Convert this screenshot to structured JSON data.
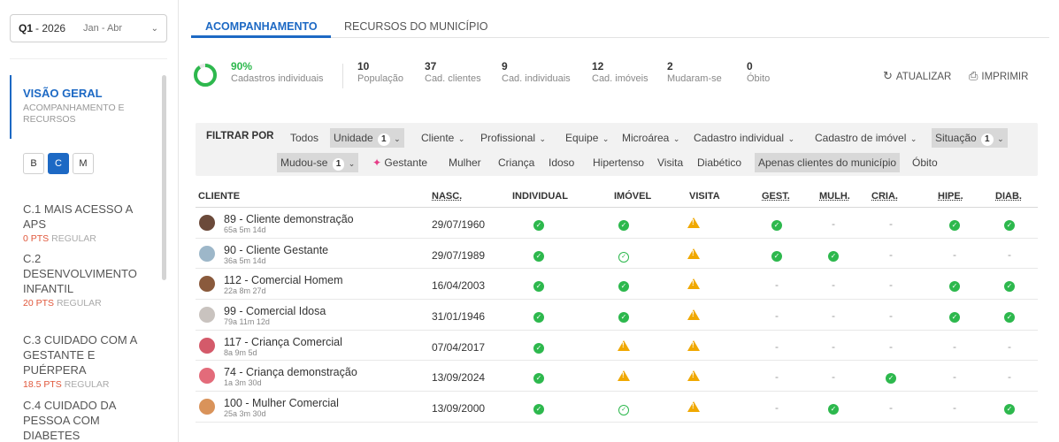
{
  "sidebar": {
    "quarter": "Q1",
    "year": "- 2026",
    "months": "Jan - Abr",
    "overview_title": "VISÃO GERAL",
    "overview_sub": "ACOMPANHAMENTO E RECURSOS",
    "level_buttons": [
      "B",
      "C",
      "M"
    ],
    "items": [
      {
        "title": "C.1 MAIS ACESSO A APS",
        "pts": "0 PTS",
        "status": "REGULAR"
      },
      {
        "title": "C.2 DESENVOLVIMENTO INFANTIL",
        "pts": "20 PTS",
        "status": "REGULAR"
      },
      {
        "title": "C.3 CUIDADO COM A GESTANTE E PUÉRPERA",
        "pts": "18.5 PTS",
        "status": "REGULAR"
      },
      {
        "title": "C.4 CUIDADO DA PESSOA COM DIABETES",
        "pts": "",
        "status": ""
      }
    ]
  },
  "tabs": [
    "ACOMPANHAMENTO",
    "RECURSOS DO MUNICÍPIO"
  ],
  "stats": {
    "pct": "90%",
    "pct_label": "Cadastros individuais",
    "items": [
      {
        "value": "10",
        "label": "População"
      },
      {
        "value": "37",
        "label": "Cad. clientes"
      },
      {
        "value": "9",
        "label": "Cad. individuais"
      },
      {
        "value": "12",
        "label": "Cad. imóveis"
      },
      {
        "value": "2",
        "label": "Mudaram-se"
      },
      {
        "value": "0",
        "label": "Óbito"
      }
    ],
    "refresh": "ATUALIZAR",
    "print": "IMPRIMIR"
  },
  "filter": {
    "label": "FILTRAR POR",
    "chips": {
      "todos": "Todos",
      "unidade": "Unidade",
      "unidade_count": "1",
      "cliente": "Cliente",
      "profissional": "Profissional",
      "equipe": "Equipe",
      "microarea": "Microárea",
      "cad_individual": "Cadastro individual",
      "cad_imovel": "Cadastro de imóvel",
      "situacao": "Situação",
      "situacao_count": "1",
      "mudou": "Mudou-se",
      "mudou_count": "1",
      "gestante": "Gestante",
      "mulher": "Mulher",
      "crianca": "Criança",
      "idoso": "Idoso",
      "hipertenso": "Hipertenso",
      "visita": "Visita",
      "diabetico": "Diabético",
      "apenas": "Apenas clientes do município",
      "obito": "Óbito"
    }
  },
  "table": {
    "headers": [
      "CLIENTE",
      "NASC.",
      "INDIVIDUAL",
      "IMÓVEL",
      "VISITA",
      "GEST.",
      "MULH.",
      "CRIA.",
      "HIPE.",
      "DIAB."
    ],
    "rows": [
      {
        "name": "89 - Cliente demonstração",
        "age": "65a 5m 14d",
        "nasc": "29/07/1960",
        "avatar": "#6b4a3a",
        "cells": [
          "ok",
          "ok",
          "warn",
          "ok",
          "-",
          "-",
          "ok",
          "ok"
        ]
      },
      {
        "name": "90 - Cliente Gestante",
        "age": "36a 5m 14d",
        "nasc": "29/07/1989",
        "avatar": "#9db7c9",
        "cells": [
          "ok",
          "okl",
          "warn",
          "ok",
          "ok",
          "-",
          "-",
          "-"
        ]
      },
      {
        "name": "112 - Comercial Homem",
        "age": "22a 8m 27d",
        "nasc": "16/04/2003",
        "avatar": "#8a5a3c",
        "cells": [
          "ok",
          "ok",
          "warn",
          "-",
          "-",
          "-",
          "ok",
          "ok"
        ]
      },
      {
        "name": "99 - Comercial Idosa",
        "age": "79a 11m 12d",
        "nasc": "31/01/1946",
        "avatar": "#c9c3bf",
        "cells": [
          "ok",
          "ok",
          "warn",
          "-",
          "-",
          "-",
          "ok",
          "ok"
        ]
      },
      {
        "name": "117 - Criança Comercial",
        "age": "8a 9m 5d",
        "nasc": "07/04/2017",
        "avatar": "#d45a6a",
        "cells": [
          "ok",
          "warn",
          "warn",
          "-",
          "-",
          "-",
          "-",
          "-"
        ]
      },
      {
        "name": "74 - Criança demonstração",
        "age": "1a 3m 30d",
        "nasc": "13/09/2024",
        "avatar": "#e36b7a",
        "cells": [
          "ok",
          "warn",
          "warn",
          "-",
          "-",
          "ok",
          "-",
          "-"
        ]
      },
      {
        "name": "100 - Mulher Comercial",
        "age": "25a 3m 30d",
        "nasc": "13/09/2000",
        "avatar": "#d9935a",
        "cells": [
          "ok",
          "okl",
          "warn",
          "-",
          "ok",
          "-",
          "-",
          "ok"
        ]
      }
    ]
  },
  "colors": {
    "accent": "#1d69c4",
    "ok": "#2db84d",
    "warn": "#f0a800",
    "pts": "#e0573b"
  }
}
